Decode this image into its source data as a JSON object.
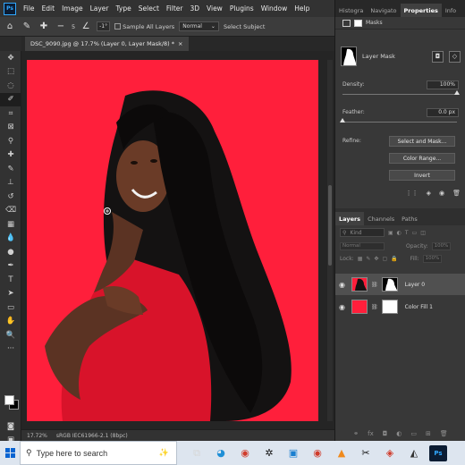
{
  "app": {
    "logo": "Ps"
  },
  "menu": [
    "File",
    "Edit",
    "Image",
    "Layer",
    "Type",
    "Select",
    "Filter",
    "3D",
    "View",
    "Plugins",
    "Window",
    "Help"
  ],
  "options": {
    "angle": "-1°",
    "sample_all_layers": "Sample All Layers",
    "mode": "Normal",
    "select_subject": "Select Subject",
    "sizes": [
      "5",
      "5"
    ]
  },
  "document": {
    "tab_title": "DSC_9090.jpg @ 17.7% (Layer 0, Layer Mask/8) *",
    "zoom": "17.72%",
    "profile": "sRGB IEC61966-2.1 (8bpc)"
  },
  "panels_top": {
    "tabs": [
      "Histogra",
      "Navigato",
      "Properties",
      "Info"
    ],
    "active": "Properties"
  },
  "properties": {
    "masks_label": "Masks",
    "layer_mask_label": "Layer Mask",
    "density_label": "Density:",
    "density_value": "100%",
    "density_fraction": 1.0,
    "feather_label": "Feather:",
    "feather_value": "0.0 px",
    "feather_fraction": 0.0,
    "refine_label": "Refine:",
    "btn_select_mask": "Select and Mask...",
    "btn_color_range": "Color Range...",
    "btn_invert": "Invert"
  },
  "layers_panel": {
    "tabs": [
      "Layers",
      "Channels",
      "Paths"
    ],
    "active": "Layers",
    "filter_kind": "Kind",
    "blend_mode": "Normal",
    "opacity_label": "Opacity:",
    "opacity_value": "100%",
    "lock_label": "Lock:",
    "fill_label": "Fill:",
    "fill_value": "100%",
    "layers": [
      {
        "name": "Layer 0",
        "selected": true
      },
      {
        "name": "Color Fill 1",
        "selected": false
      }
    ]
  },
  "taskbar": {
    "search_placeholder": "Type here to search"
  },
  "colors": {
    "canvas_fill": "#ff1f3b",
    "accent": "#31a8ff"
  }
}
